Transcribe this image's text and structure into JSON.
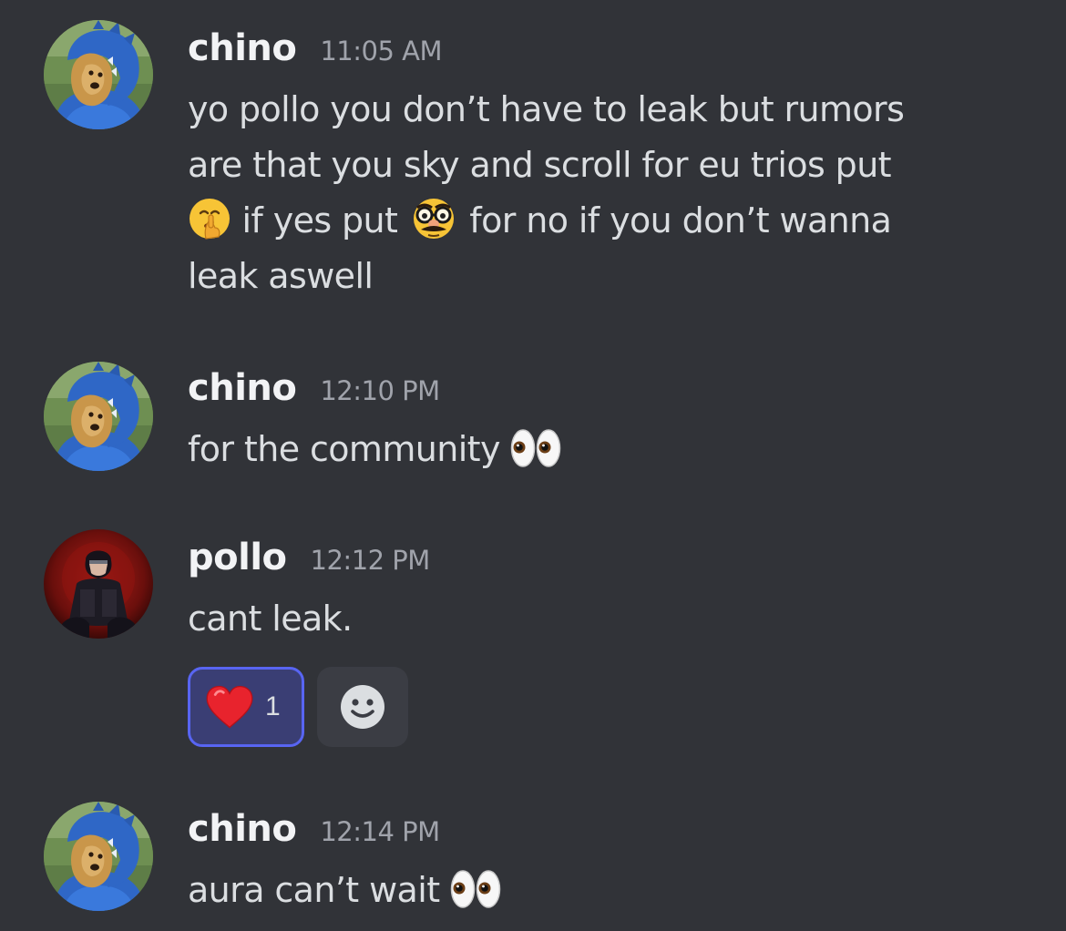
{
  "messages": [
    {
      "username": "chino",
      "timestamp": "11:05 AM",
      "lines": [
        "yo pollo you don’t have to leak but rumors",
        "are that you sky and scroll for eu trios put",
        " if yes put ",
        " for no if you don’t wanna",
        "leak aswell"
      ],
      "emojis": [
        "shushing-face",
        "disguised-face"
      ]
    },
    {
      "username": "chino",
      "timestamp": "12:10 PM",
      "text": "for the community",
      "emojis": [
        "eyes"
      ]
    },
    {
      "username": "pollo",
      "timestamp": "12:12 PM",
      "text": "cant leak.",
      "reactions": [
        {
          "emoji": "red-heart",
          "count": "1"
        }
      ],
      "add_reaction_icon": "smiley-add-reaction-icon"
    },
    {
      "username": "chino",
      "timestamp": "12:14 PM",
      "text": "aura can’t wait",
      "emojis": [
        "eyes"
      ]
    }
  ],
  "colors": {
    "background": "#313338",
    "username": "#f2f3f5",
    "timestamp": "#a0a3ab",
    "message_text": "#dbdee1",
    "reaction_active_bg": "#3a3e74",
    "reaction_active_border": "#5865f2"
  }
}
